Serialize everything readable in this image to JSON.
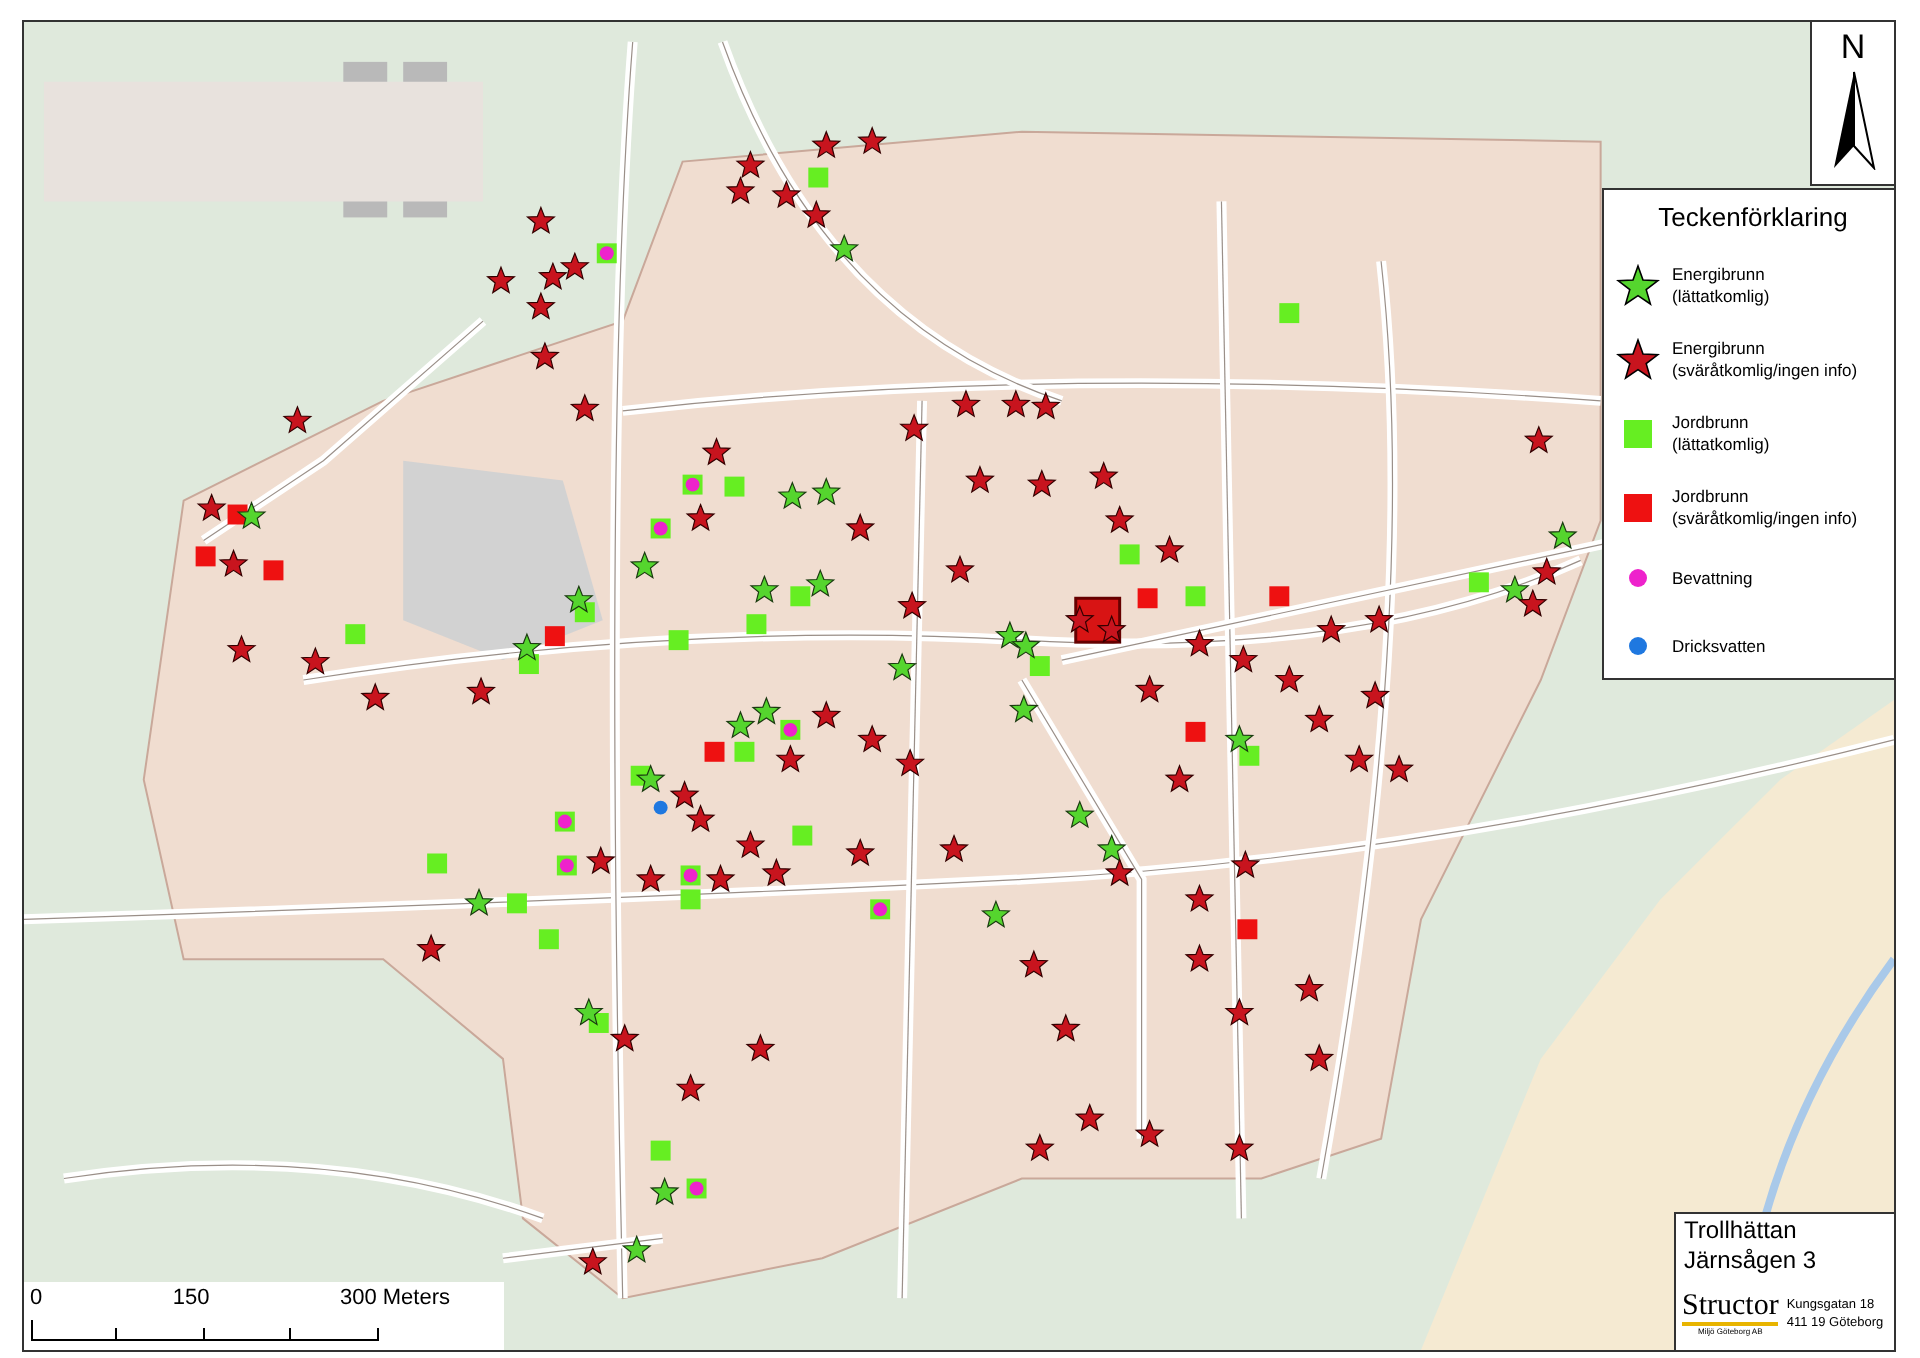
{
  "north_arrow": {
    "label": "N"
  },
  "legend": {
    "title": "Teckenförklaring",
    "items": [
      {
        "kind": "star",
        "color": "#55d52e",
        "label": "Energibrunn",
        "note": "(lättatkomlig)"
      },
      {
        "kind": "star",
        "color": "#c8141e",
        "label": "Energibrunn",
        "note": "(sväråtkomlig/ingen info)"
      },
      {
        "kind": "square",
        "color": "#66ee22",
        "label": "Jordbrunn",
        "note": "(lättatkomlig)"
      },
      {
        "kind": "square",
        "color": "#ee1111",
        "label": "Jordbrunn",
        "note": "(sväråtkomlig/ingen info)"
      },
      {
        "kind": "dot",
        "color": "#ee22cc",
        "label": "Bevattning"
      },
      {
        "kind": "dot",
        "color": "#1f78e0",
        "label": "Dricksvatten"
      }
    ]
  },
  "scale_bar": {
    "ticks": [
      "0",
      "150",
      "300 Meters"
    ]
  },
  "title_block": {
    "place": "Trollhättan",
    "project": "Järnsågen 3"
  },
  "company": {
    "logo": "Structor",
    "subtitle": "Miljö Göteborg AB",
    "address": [
      "Kungsgatan 18",
      "411 19 Göteborg"
    ]
  }
}
